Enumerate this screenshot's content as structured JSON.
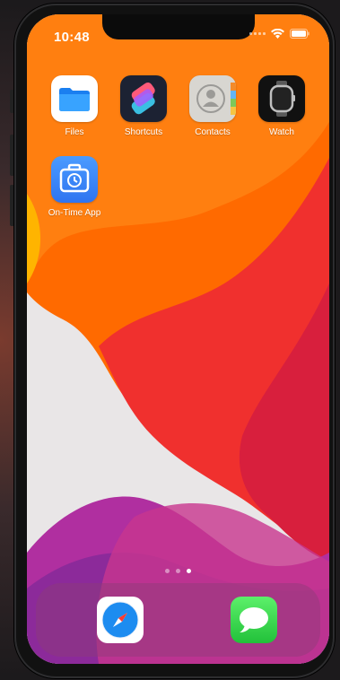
{
  "status_bar": {
    "time": "10:48"
  },
  "apps": [
    {
      "name": "files",
      "label": "Files"
    },
    {
      "name": "shortcuts",
      "label": "Shortcuts"
    },
    {
      "name": "contacts",
      "label": "Contacts"
    },
    {
      "name": "watch",
      "label": "Watch"
    },
    {
      "name": "on-time",
      "label": "On-Time App"
    }
  ],
  "page_indicator": {
    "count": 3,
    "active": 3
  },
  "dock": [
    {
      "name": "safari-icon"
    },
    {
      "name": "messages-icon"
    }
  ],
  "colors": {
    "wall_orange": "#ff6a00",
    "wall_red": "#f0302e",
    "wall_pink": "#d6449a"
  }
}
